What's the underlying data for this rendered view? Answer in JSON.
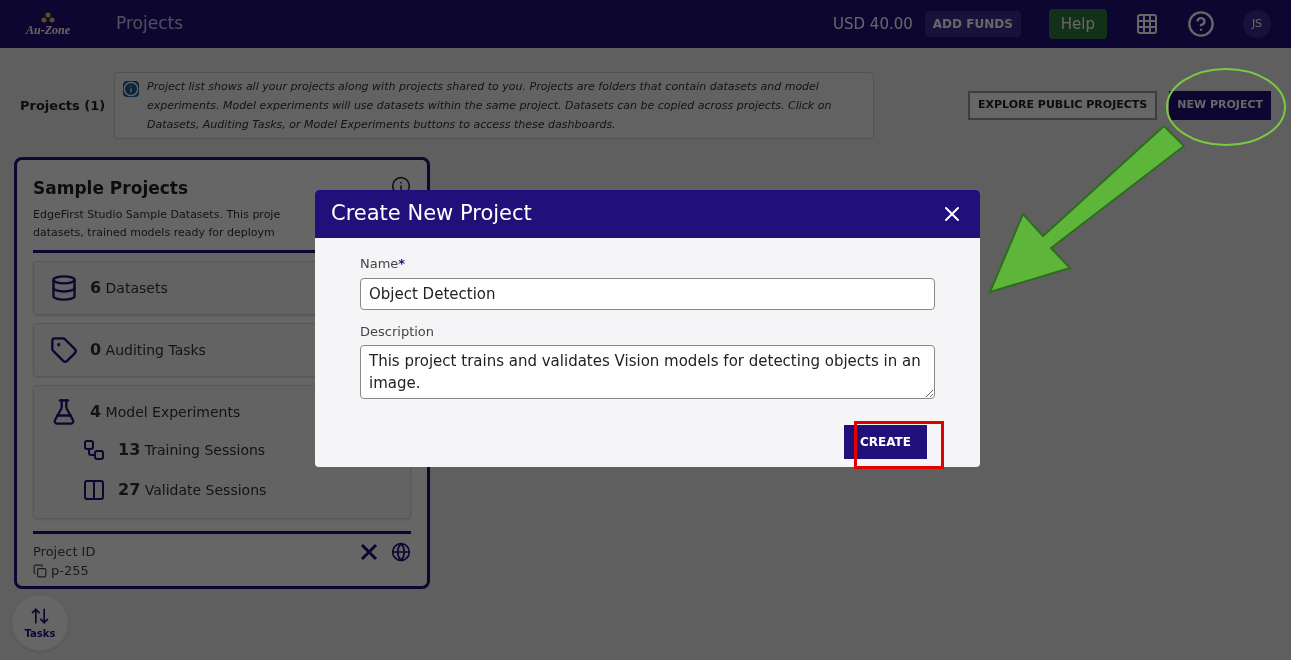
{
  "header": {
    "logo_text": "Au-Zone",
    "title": "Projects",
    "balance": "USD 40.00",
    "add_funds": "ADD FUNDS",
    "help": "Help",
    "avatar": "JS"
  },
  "toolbar": {
    "heading": "Projects (1)",
    "info": "Project list shows all your projects along with projects shared to you. Projects are folders that contain datasets and model experiments. Model experiments will use datasets within the same project. Datasets can be copied across projects. Click on Datasets, Auditing Tasks, or Model Experiments buttons to access these dashboards.",
    "explore": "EXPLORE PUBLIC PROJECTS",
    "new_project": "NEW PROJECT"
  },
  "card": {
    "title": "Sample Projects",
    "description_lines": [
      "EdgeFirst Studio Sample Datasets. This proje",
      "datasets, trained models ready for deploym"
    ],
    "rows": [
      {
        "kind": "datasets",
        "count": "6",
        "label": "Datasets"
      },
      {
        "kind": "auditing",
        "count": "0",
        "label": "Auditing Tasks"
      },
      {
        "kind": "experiments",
        "count": "4",
        "label": "Model Experiments",
        "children": [
          {
            "kind": "training",
            "count": "13",
            "label": "Training Sessions"
          },
          {
            "kind": "validate",
            "count": "27",
            "label": "Validate Sessions"
          }
        ]
      }
    ],
    "project_id_label": "Project ID",
    "project_id": "p-255"
  },
  "tasks_button": "Tasks",
  "dialog": {
    "title": "Create New Project",
    "fields": [
      {
        "kind": "text",
        "label": "Name",
        "required_mark": "*",
        "value": "Object Detection"
      },
      {
        "kind": "textarea",
        "label": "Description",
        "value": "This project trains and validates Vision models for detecting objects in an image."
      }
    ],
    "create": "CREATE"
  }
}
